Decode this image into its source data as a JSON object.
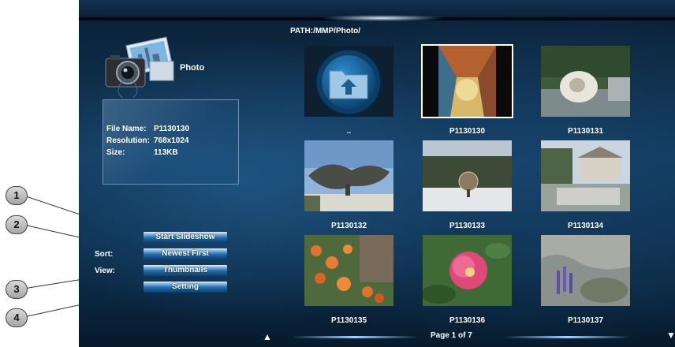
{
  "header": {
    "path": "PATH:/MMP/Photo/"
  },
  "sidebar": {
    "title": "Photo",
    "info": {
      "file_name_label": "File Name:",
      "file_name": "P1130130",
      "resolution_label": "Resolution:",
      "resolution": "768x1024",
      "size_label": "Size:",
      "size": "113KB"
    },
    "sort_label": "Sort:",
    "view_label": "View:",
    "buttons": [
      "Start Slideshow",
      "Newest First",
      "Thumbnails",
      "Setting"
    ]
  },
  "grid": {
    "items": [
      {
        "label": "..",
        "kind": "parent-folder"
      },
      {
        "label": "P1130130",
        "kind": "photo",
        "selected": true
      },
      {
        "label": "P1130131",
        "kind": "photo"
      },
      {
        "label": "P1130132",
        "kind": "photo"
      },
      {
        "label": "P1130133",
        "kind": "photo"
      },
      {
        "label": "P1130134",
        "kind": "photo"
      },
      {
        "label": "P1130135",
        "kind": "photo"
      },
      {
        "label": "P1130136",
        "kind": "photo"
      },
      {
        "label": "P1130137",
        "kind": "photo"
      }
    ]
  },
  "pager": {
    "text": "Page 1 of 7"
  },
  "callouts": [
    "1",
    "2",
    "3",
    "4"
  ],
  "icons": {
    "photo_app": "photo-camera-icon",
    "up_folder": "folder-up-icon",
    "page_up": "triangle-up-icon",
    "page_down": "triangle-down-icon"
  },
  "colors": {
    "selection": "#ffffff",
    "button_blue": "#1f6aa9",
    "background": "#123a5c"
  }
}
